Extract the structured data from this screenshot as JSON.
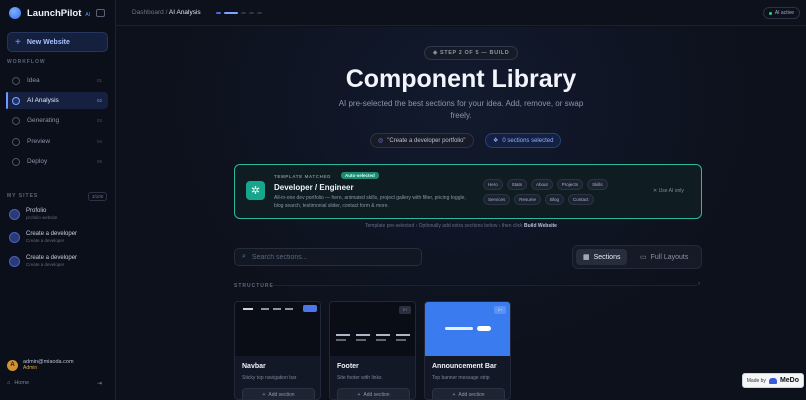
{
  "brand": {
    "name": "LaunchPilot",
    "badge": "AI"
  },
  "sidebar": {
    "new_website": "New Website",
    "workflow_label": "WORKFLOW",
    "workflow": [
      {
        "label": "Idea",
        "num": "01"
      },
      {
        "label": "AI Analysis",
        "num": "02"
      },
      {
        "label": "Generating",
        "num": "03"
      },
      {
        "label": "Preview",
        "num": "04"
      },
      {
        "label": "Deploy",
        "num": "05"
      }
    ],
    "my_sites_label": "MY SITES",
    "sites_count": "3/100",
    "sites": [
      {
        "title": "Profolio",
        "sub": "profolio website"
      },
      {
        "title": "Create a developer",
        "sub": "Create a developer"
      },
      {
        "title": "Create a developer",
        "sub": "Create a developer"
      }
    ],
    "user": {
      "initial": "A",
      "email": "admin@miaoda.com",
      "role": "Admin"
    },
    "home": "Home"
  },
  "topbar": {
    "crumb_root": "Dashboard",
    "crumb_sep": "/",
    "crumb_current": "AI Analysis",
    "ai_status": "AI active"
  },
  "main": {
    "step": "STEP 2 OF 5 — BUILD",
    "title": "Component Library",
    "subtitle": "AI pre-selected the best sections for your idea. Add, remove, or swap freely.",
    "prompt_chip": "\"Create a developer portfolio\"",
    "sections_chip": "0 sections selected",
    "template": {
      "matched": "TEMPLATE MATCHED",
      "badge": "Auto-selected",
      "name": "Developer / Engineer",
      "desc": "All-in-one dev portfolio — hero, animated skills, project gallery with filter, pricing toggle, blog search, testimonial slider, contact form & more.",
      "tags": [
        "Hero",
        "Stats",
        "About",
        "Projects",
        "Skills",
        "Services",
        "Resume",
        "Blog",
        "Contact"
      ],
      "use_ai": "Use AI only"
    },
    "hint_text": "Template pre-selected ›  Optionally add extra sections below  ›  then click",
    "hint_bold": "Build Website",
    "search_placeholder": "Search sections...",
    "view_sections": "Sections",
    "view_full": "Full Layouts",
    "structure_label": "STRUCTURE",
    "cards": [
      {
        "title": "Navbar",
        "desc": "Sticky top navigation bar",
        "btn": "Add section",
        "badge": ""
      },
      {
        "title": "Footer",
        "desc": "Site footer with links",
        "btn": "Add section",
        "badge": "2+"
      },
      {
        "title": "Announcement Bar",
        "desc": "Top banner message strip",
        "btn": "Add section",
        "badge": "2+"
      }
    ]
  },
  "made_by": {
    "prefix": "Made by",
    "name": "MeDo"
  },
  "colors": {
    "accent": "#6e98ff",
    "teal": "#2db79b",
    "bg": "#0d111c"
  }
}
